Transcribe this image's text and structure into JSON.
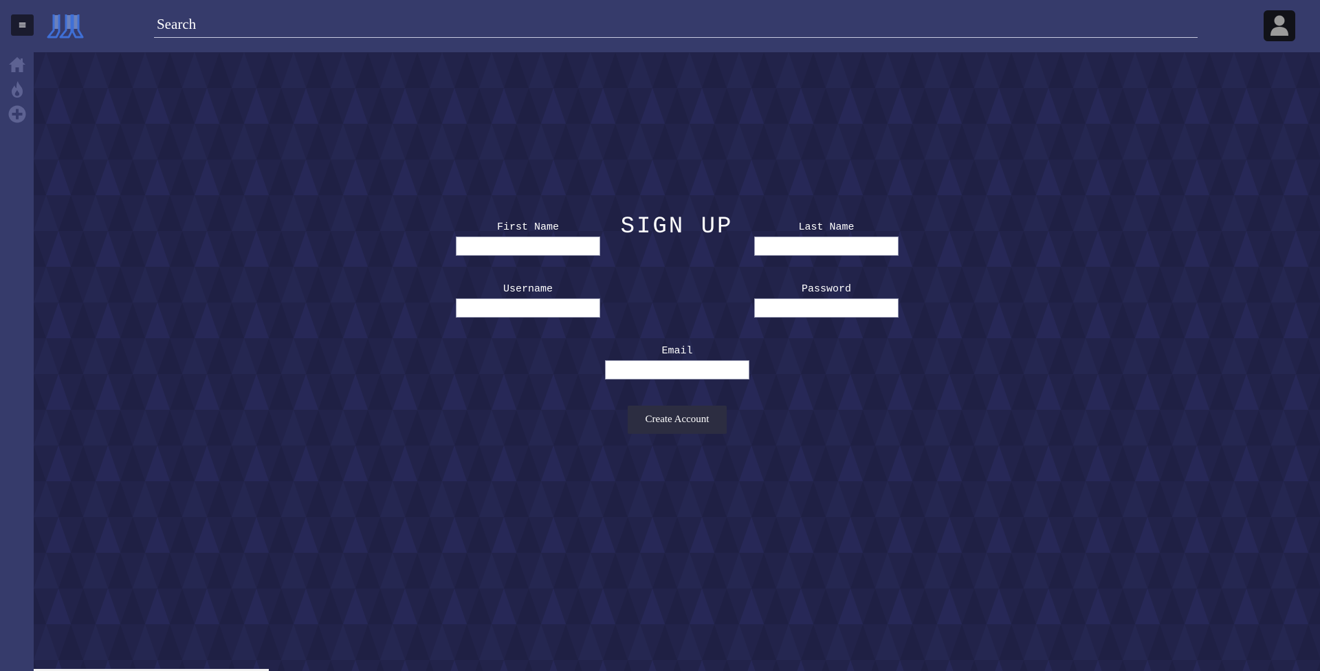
{
  "header": {
    "menu_icon": "≡",
    "logo_icon": "logo-icon",
    "search_placeholder": "Search",
    "search_value": "",
    "avatar_icon": "user-icon"
  },
  "sidebar": {
    "items": [
      {
        "name": "home",
        "icon": "home-icon"
      },
      {
        "name": "trending",
        "icon": "flame-icon"
      },
      {
        "name": "create",
        "icon": "plus-circle-icon"
      }
    ]
  },
  "form": {
    "title": "SIGN UP",
    "first_name_label": "First Name",
    "first_name_value": "",
    "last_name_label": "Last Name",
    "last_name_value": "",
    "username_label": "Username",
    "username_value": "",
    "password_label": "Password",
    "password_value": "",
    "email_label": "Email",
    "email_value": "",
    "submit_label": "Create Account"
  },
  "colors": {
    "topbar": "#363b6b",
    "background": "#22234a",
    "button": "#2c2d41",
    "logo": "#4a7bd9"
  }
}
